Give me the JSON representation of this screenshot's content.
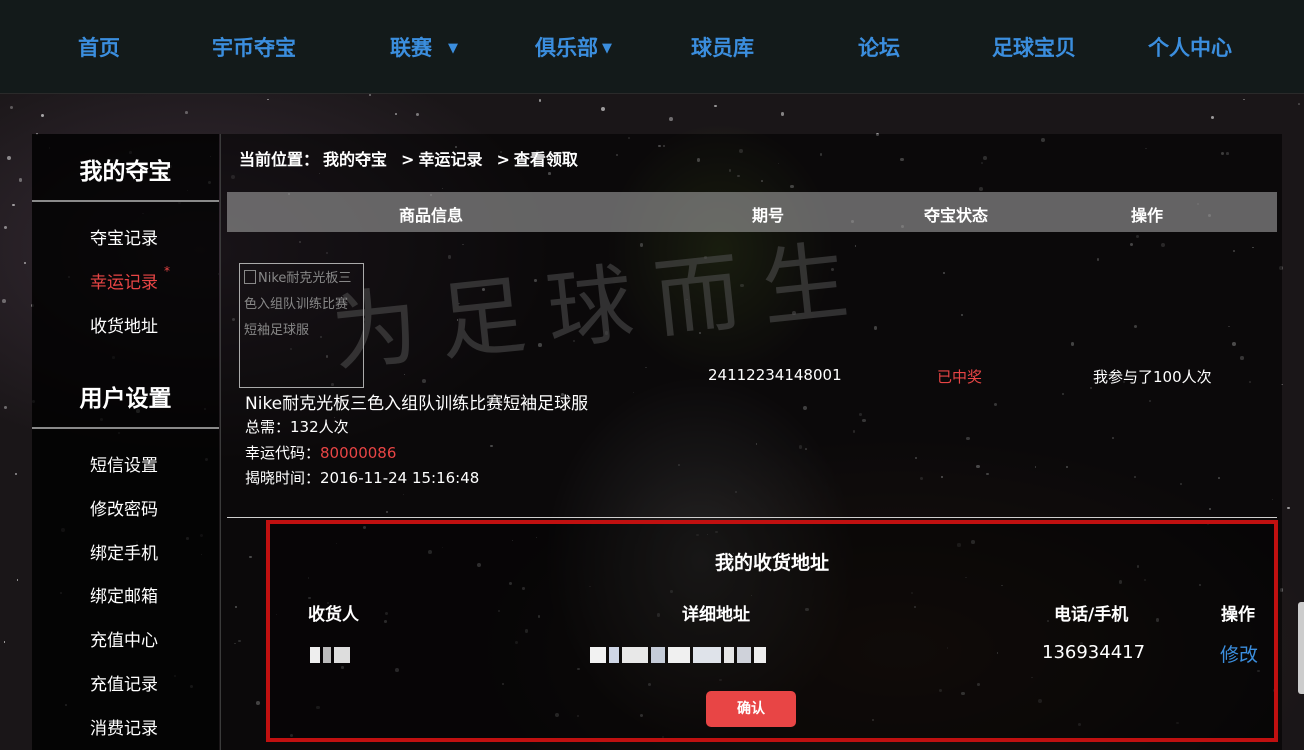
{
  "nav": {
    "items": [
      {
        "label": "首页"
      },
      {
        "label": "宇币夺宝"
      },
      {
        "label": "联赛",
        "caret": "▼"
      },
      {
        "label": "俱乐部",
        "caret": "▼"
      },
      {
        "label": "球员库"
      },
      {
        "label": "论坛"
      },
      {
        "label": "足球宝贝"
      },
      {
        "label": "个人中心"
      }
    ]
  },
  "sidebar": {
    "section1_title": "我的夺宝",
    "section1_items": [
      {
        "label": "夺宝记录"
      },
      {
        "label": "幸运记录",
        "active": true,
        "marker": "*"
      },
      {
        "label": "收货地址"
      }
    ],
    "section2_title": "用户设置",
    "section2_items": [
      {
        "label": "短信设置"
      },
      {
        "label": "修改密码"
      },
      {
        "label": "绑定手机"
      },
      {
        "label": "绑定邮箱"
      },
      {
        "label": "充值中心"
      },
      {
        "label": "充值记录"
      },
      {
        "label": "消费记录"
      }
    ]
  },
  "breadcrumb": {
    "prefix": "当前位置：",
    "items": [
      "我的夺宝",
      "幸运记录",
      "查看领取"
    ],
    "separator": ">"
  },
  "record_table": {
    "headers": [
      "商品信息",
      "期号",
      "夺宝状态",
      "操作"
    ],
    "row": {
      "image_alt": "Nike耐克光板三色入组队训练比赛短袖足球服",
      "title": "Nike耐克光板三色入组队训练比赛短袖足球服",
      "required_label": "总需：",
      "required_value": "132人次",
      "lucky_code_label": "幸运代码：",
      "lucky_code_value": "80000086",
      "reveal_time_label": "揭晓时间：",
      "reveal_time_value": "2016-11-24 15:16:48",
      "period": "24112234148001",
      "status": "已中奖",
      "action": "我参与了100人次"
    }
  },
  "watermark_text": "为足球而生",
  "address": {
    "title": "我的收货地址",
    "headers": [
      "收货人",
      "详细地址",
      "电话/手机",
      "操作"
    ],
    "phone": "136934417",
    "edit_label": "修改",
    "confirm_label": "确认"
  },
  "colors": {
    "nav_link": "#3b8ede",
    "active_red": "#e84545",
    "highlight_border": "#c01010"
  }
}
